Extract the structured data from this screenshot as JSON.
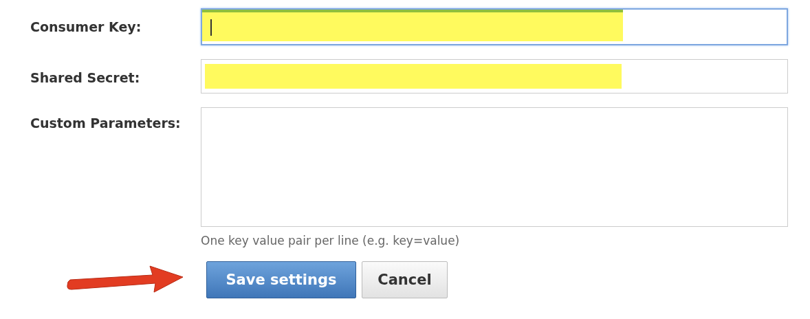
{
  "fields": [
    {
      "label": "Consumer Key:",
      "kind": "input",
      "focused": true,
      "redacted": true
    },
    {
      "label": "Shared Secret:",
      "kind": "input",
      "focused": false,
      "redacted": true
    },
    {
      "label": "Custom Parameters:",
      "kind": "textarea",
      "focused": false,
      "redacted": false,
      "hint": "One key value pair per line (e.g. key=value)"
    }
  ],
  "buttons": [
    {
      "label": "Save settings",
      "kind": "primary"
    },
    {
      "label": "Cancel",
      "kind": "secondary"
    }
  ]
}
